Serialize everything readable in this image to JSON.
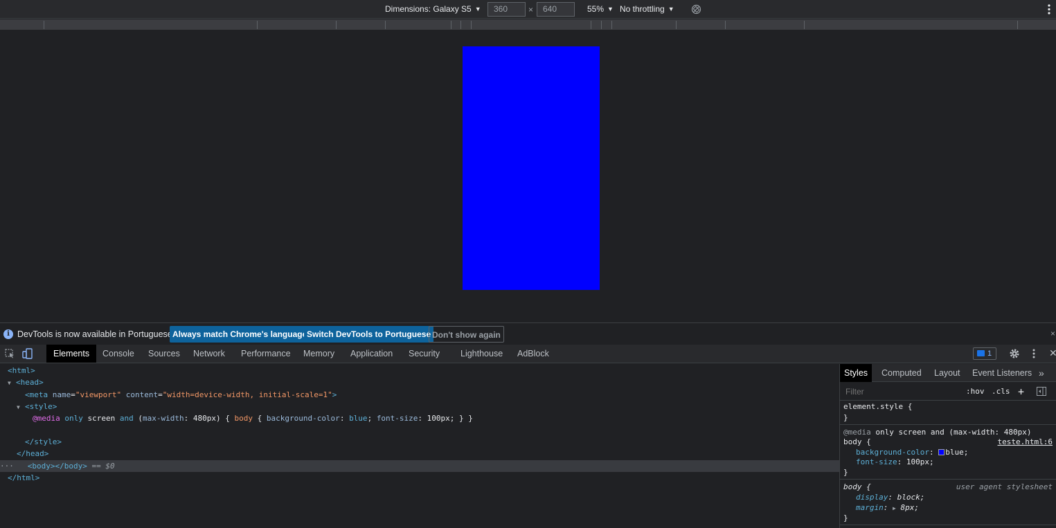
{
  "device_toolbar": {
    "dimensions_label": "Dimensions: Galaxy S5",
    "width_value": "360",
    "height_value": "640",
    "times": "×",
    "zoom": "55%",
    "throttling": "No throttling"
  },
  "device_screen": {
    "background_color": "#0000ff"
  },
  "infobar": {
    "message": "DevTools is now available in Portuguese!",
    "btn_match": "Always match Chrome's language",
    "btn_switch": "Switch DevTools to Portuguese",
    "btn_dont_show": "Don't show again"
  },
  "tabs": {
    "elements": "Elements",
    "console": "Console",
    "sources": "Sources",
    "network": "Network",
    "performance": "Performance",
    "memory": "Memory",
    "application": "Application",
    "security": "Security",
    "lighthouse": "Lighthouse",
    "adblock": "AdBlock",
    "issues_count": "1"
  },
  "dom": {
    "html_open": "<html>",
    "head_open": "<head>",
    "meta_tag_open": "<meta",
    "meta_name_attr": "name",
    "meta_name_val": "\"viewport\"",
    "meta_content_attr": "content",
    "meta_content_val": "\"width=device-width, initial-scale=1\"",
    "meta_close": ">",
    "style_open": "<style>",
    "css_media": "@media",
    "css_only": "only",
    "css_screen": "screen",
    "css_and": "and",
    "css_paren_open": "(",
    "css_maxwidth": "max-width",
    "css_480": ": 480px)",
    "css_brace_open": " { ",
    "css_body": "body",
    "css_brace2": " { ",
    "css_bg_prop": "background-color",
    "css_colon1": ": ",
    "css_blue": "blue",
    "css_semi1": "; ",
    "css_fs_prop": "font-size",
    "css_fs_val": ": 100px; } }",
    "style_close": "</style>",
    "head_close": "</head>",
    "body_line": "<body></body>",
    "eq0": " == $0",
    "html_close": "</html>",
    "ellipsis": "···"
  },
  "styles": {
    "tabs": {
      "styles": "Styles",
      "computed": "Computed",
      "layout": "Layout",
      "event_listeners": "Event Listeners",
      "more": "»"
    },
    "filter_placeholder": "Filter",
    "hov": ":hov",
    "cls": ".cls",
    "plus": "+",
    "element_style_selector": "element.style {",
    "close_brace": "}",
    "media_query_at": "@media",
    "media_query_rest": " only screen and (max-width: 480px)",
    "body_selector": "body {",
    "source_link": "teste.html:6",
    "bg_prop": "background-color",
    "bg_val": "blue;",
    "fs_prop": "font-size",
    "fs_val": ": 100px;",
    "ua_selector": "body {",
    "ua_label": "user agent stylesheet",
    "display_prop": "display",
    "display_val": ": block;",
    "margin_prop": "margin",
    "margin_val": "8px;",
    "swatch_color": "#0000ff"
  }
}
